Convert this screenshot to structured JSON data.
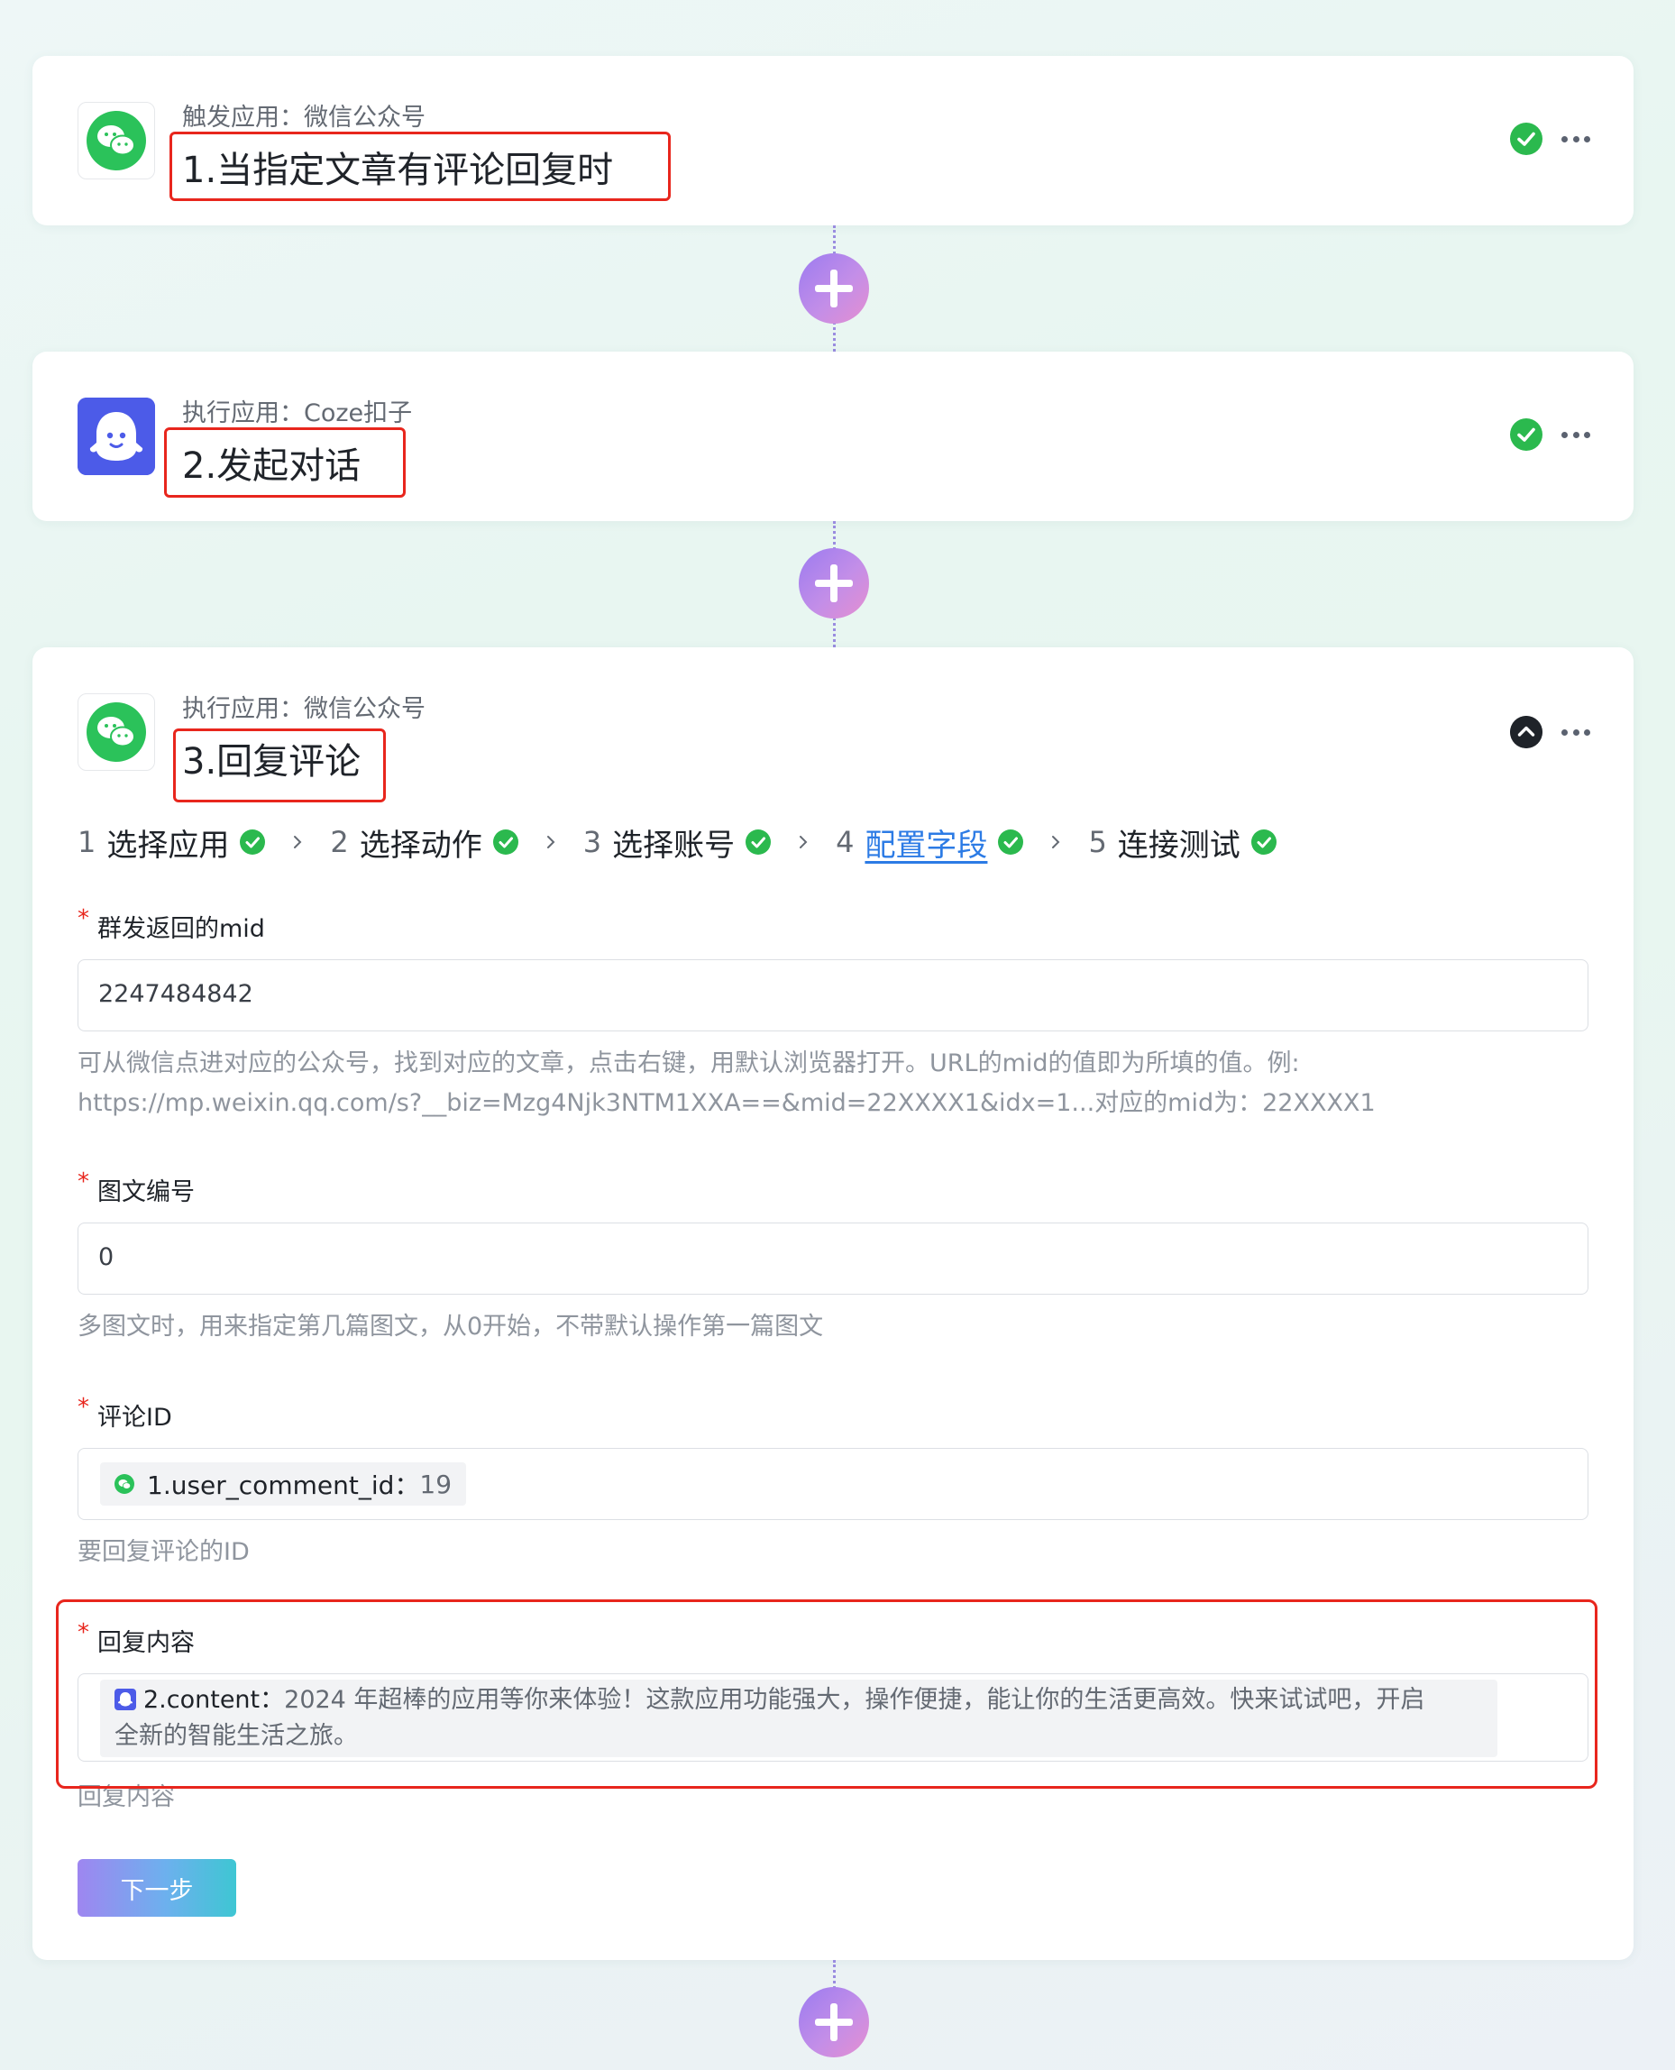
{
  "colors": {
    "accent": "#2c7be5",
    "success": "#2bb94e",
    "required": "#e8261d",
    "button_gradient": [
      "#9e86f0",
      "#3ec6d3"
    ]
  },
  "step1": {
    "app_label": "触发应用：微信公众号",
    "title": "1.当指定文章有评论回复时",
    "icon": "wechat-icon"
  },
  "step2": {
    "app_label": "执行应用：Coze扣子",
    "title": "2.发起对话",
    "icon": "coze-icon"
  },
  "step3": {
    "app_label": "执行应用：微信公众号",
    "title": "3.回复评论",
    "icon": "wechat-icon",
    "wizard": [
      {
        "num": "1",
        "label": "选择应用"
      },
      {
        "num": "2",
        "label": "选择动作"
      },
      {
        "num": "3",
        "label": "选择账号"
      },
      {
        "num": "4",
        "label": "配置字段"
      },
      {
        "num": "5",
        "label": "连接测试"
      }
    ],
    "fields": {
      "mid": {
        "required_mark": "*",
        "label": "群发返回的mid",
        "value": "2247484842",
        "hint_line1": "可从微信点进对应的公众号，找到对应的文章，点击右键，用默认浏览器打开。URL的mid的值即为所填的值。例:",
        "hint_line2": "https://mp.weixin.qq.com/s?__biz=Mzg4Njk3NTM1XXA==&mid=22XXXX1&idx=1...对应的mid为：22XXXX1"
      },
      "article_index": {
        "required_mark": "*",
        "label": "图文编号",
        "value": "0",
        "hint": "多图文时，用来指定第几篇图文，从0开始，不带默认操作第一篇图文"
      },
      "comment_id": {
        "required_mark": "*",
        "label": "评论ID",
        "chip_key": "1.user_comment_id：",
        "chip_value": "19",
        "hint": "要回复评论的ID"
      },
      "reply_content": {
        "required_mark": "*",
        "label": "回复内容",
        "chip_key": "2.content：",
        "chip_value_line1": "2024 年超棒的应用等你来体验！这款应用功能强大，操作便捷，能让你的生活更高效。快来试试吧，开启",
        "chip_value_line2": "全新的智能生活之旅。",
        "hint": "回复内容"
      }
    },
    "next_button": "下一步"
  }
}
